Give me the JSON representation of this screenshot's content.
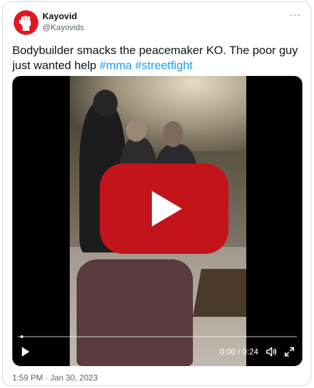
{
  "author": {
    "name": "Kayovid",
    "handle": "@Kayovids",
    "avatar_icon": "raised-fist-icon",
    "avatar_color": "#e0191f"
  },
  "more_icon": "···",
  "tweet": {
    "text": "Bodybuilder smacks the peacemaker KO. The poor guy just wanted help ",
    "hashtags": [
      "#mma",
      "#streetfight"
    ]
  },
  "video": {
    "progress": 0,
    "time": "0:00 / 0:24",
    "play_icon": "play-icon",
    "volume_icon": "volume-icon",
    "fullscreen_icon": "fullscreen-icon",
    "overlay_icon": "youtube-play-icon",
    "overlay_color": "#c4141b"
  },
  "timestamp": "1:59 PM · Jan 30, 2023",
  "colors": {
    "link": "#1d9bf0",
    "text": "#0f1419",
    "muted": "#536471",
    "border": "#cfd9de"
  }
}
